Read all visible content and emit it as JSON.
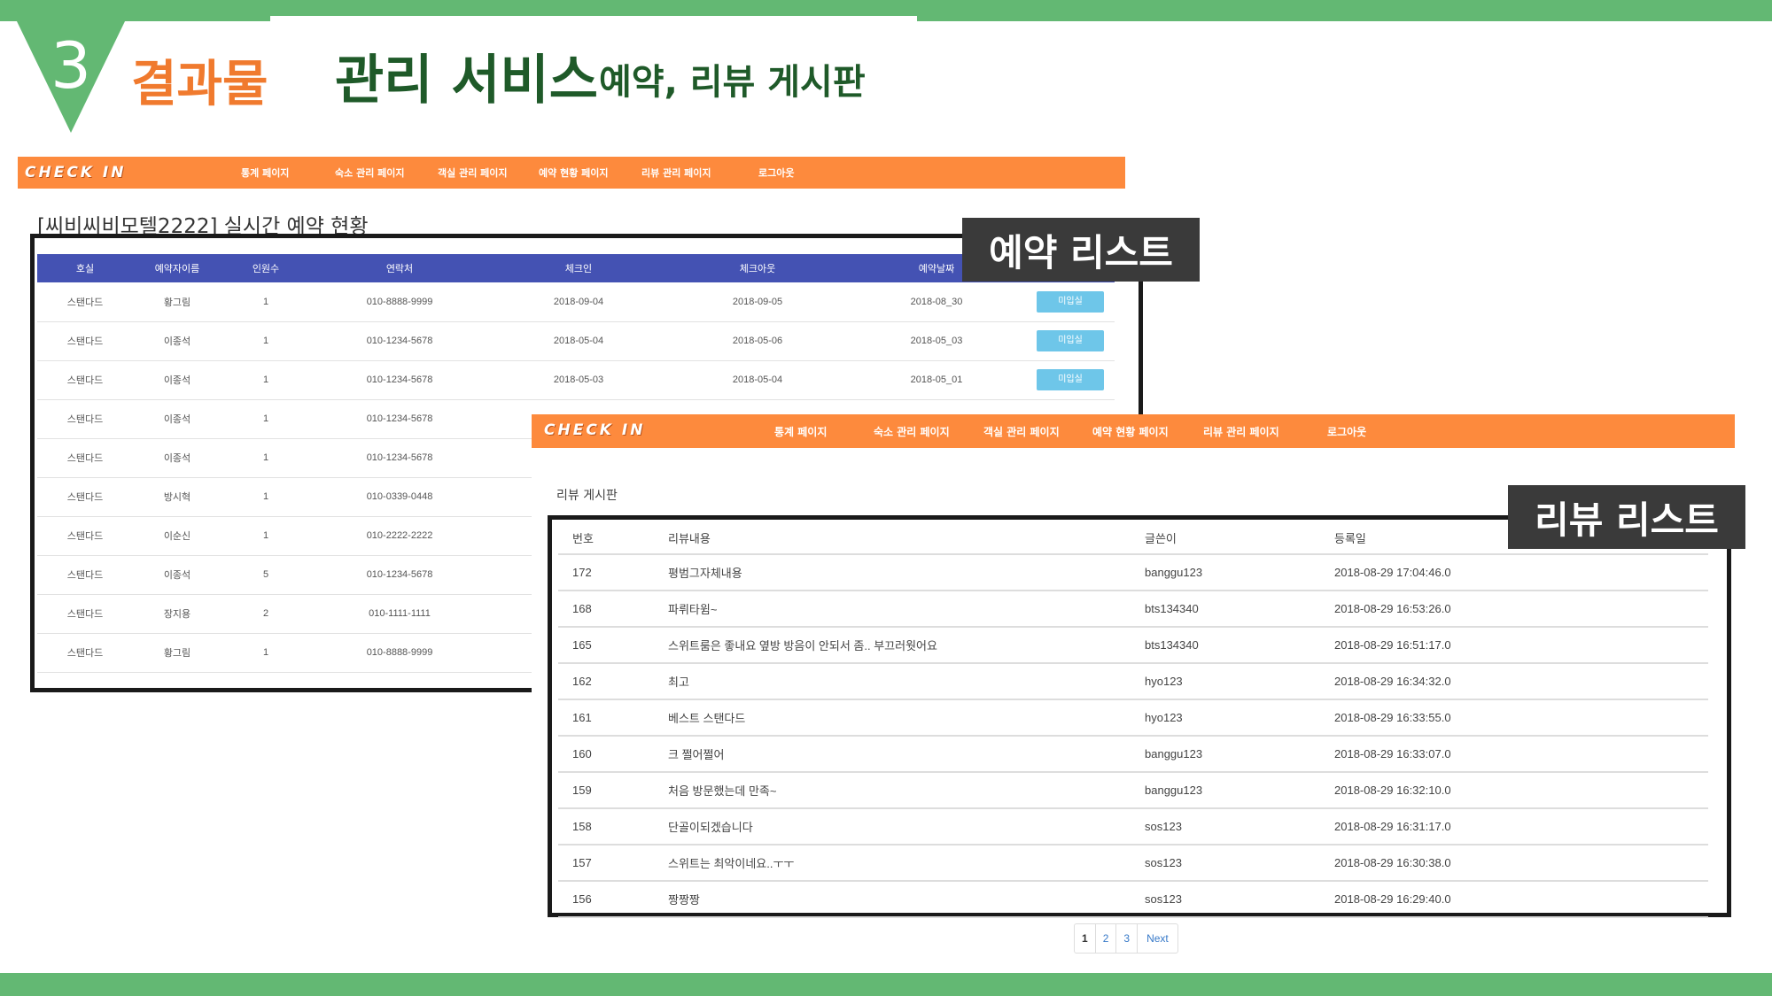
{
  "slide": {
    "number": "3",
    "kicker": "결과물",
    "title": "관리 서비스",
    "subtitle": "예약, 리뷰 게시판",
    "theme_color": "#63b873",
    "accent_color": "#f07a2e"
  },
  "reservation_app": {
    "brand": "CHECK IN",
    "nav": [
      "통계 페이지",
      "숙소 관리 페이지",
      "객실 관리 페이지",
      "예약 현황 페이지",
      "리뷰 관리 페이지",
      "로그아웃"
    ],
    "heading": "[씨비씨비모텔2222] 실시간 예약 현황",
    "columns": [
      "호실",
      "예약자이름",
      "인원수",
      "연락처",
      "체크인",
      "체크아웃",
      "예약날짜",
      ""
    ],
    "rows": [
      [
        "스탠다드",
        "황그림",
        "1",
        "010-8888-9999",
        "2018-09-04",
        "2018-09-05",
        "2018-08_30",
        "미입실"
      ],
      [
        "스탠다드",
        "이종석",
        "1",
        "010-1234-5678",
        "2018-05-04",
        "2018-05-06",
        "2018-05_03",
        "미입실"
      ],
      [
        "스탠다드",
        "이종석",
        "1",
        "010-1234-5678",
        "2018-05-03",
        "2018-05-04",
        "2018-05_01",
        "미입실"
      ],
      [
        "스탠다드",
        "이종석",
        "1",
        "010-1234-5678",
        "",
        "",
        "",
        ""
      ],
      [
        "스탠다드",
        "이종석",
        "1",
        "010-1234-5678",
        "",
        "",
        "",
        ""
      ],
      [
        "스탠다드",
        "방시혁",
        "1",
        "010-0339-0448",
        "",
        "",
        "",
        ""
      ],
      [
        "스탠다드",
        "이순신",
        "1",
        "010-2222-2222",
        "",
        "",
        "",
        ""
      ],
      [
        "스탠다드",
        "이종석",
        "5",
        "010-1234-5678",
        "",
        "",
        "",
        ""
      ],
      [
        "스탠다드",
        "장지용",
        "2",
        "010-1111-1111",
        "",
        "",
        "",
        ""
      ],
      [
        "스탠다드",
        "황그림",
        "1",
        "010-8888-9999",
        "",
        "",
        "",
        ""
      ]
    ],
    "tag": "예약 리스트",
    "header_color": "#4452b3",
    "nav_color": "#fd8a3d",
    "button_color": "#6ec6e9"
  },
  "review_app": {
    "brand": "CHECK IN",
    "nav": [
      "통계 페이지",
      "숙소 관리 페이지",
      "객실 관리 페이지",
      "예약 현황 페이지",
      "리뷰 관리 페이지",
      "로그아웃"
    ],
    "heading": "리뷰 게시판",
    "columns": [
      "번호",
      "리뷰내용",
      "글쓴이",
      "등록일"
    ],
    "rows": [
      [
        "172",
        "평범그자체내용",
        "banggu123",
        "2018-08-29 17:04:46.0"
      ],
      [
        "168",
        "파뤼타윔~",
        "bts134340",
        "2018-08-29 16:53:26.0"
      ],
      [
        "165",
        "스위트룸은 좋내요 옆방 방음이 안되서 좀.. 부끄러웟어요",
        "bts134340",
        "2018-08-29 16:51:17.0"
      ],
      [
        "162",
        "최고",
        "hyo123",
        "2018-08-29 16:34:32.0"
      ],
      [
        "161",
        "베스트 스탠다드",
        "hyo123",
        "2018-08-29 16:33:55.0"
      ],
      [
        "160",
        "크 쩔어쩔어",
        "banggu123",
        "2018-08-29 16:33:07.0"
      ],
      [
        "159",
        "처음 방문했는데 만족~",
        "banggu123",
        "2018-08-29 16:32:10.0"
      ],
      [
        "158",
        "단골이되겠습니다",
        "sos123",
        "2018-08-29 16:31:17.0"
      ],
      [
        "157",
        "스위트는 최악이네요..ㅜㅜ",
        "sos123",
        "2018-08-29 16:30:38.0"
      ],
      [
        "156",
        "짱짱짱",
        "sos123",
        "2018-08-29 16:29:40.0"
      ]
    ],
    "tag": "리뷰 리스트",
    "pagination": [
      "1",
      "2",
      "3",
      "Next"
    ],
    "current_page": "1"
  }
}
